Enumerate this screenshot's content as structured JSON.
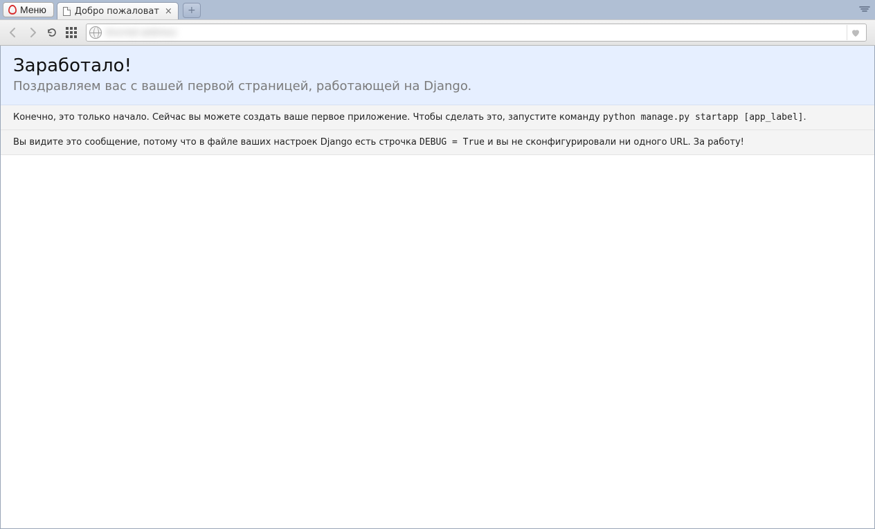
{
  "chrome": {
    "menu_label": "Меню",
    "tab_title": "Добро пожаловат",
    "url_display": "blurred address"
  },
  "page": {
    "title": "Заработало!",
    "subtitle": "Поздравляем вас с вашей первой страницей, работающей на Django.",
    "info1_pre": "Конечно, это только начало. Сейчас вы можете создать ваше первое приложение. Чтобы сделать это, запустите команду ",
    "info1_code": "python manage.py startapp [app_label]",
    "info1_post": ".",
    "info2_pre": "Вы видите это сообщение, потому что в файле ваших настроек Django есть строчка ",
    "info2_code": "DEBUG = True",
    "info2_post": " и вы не сконфигурировали ни одного URL. За работу!"
  }
}
